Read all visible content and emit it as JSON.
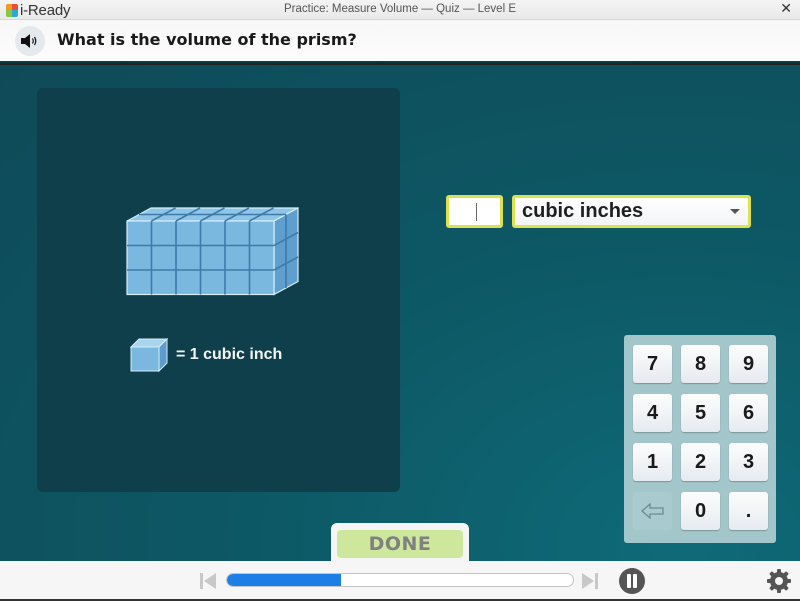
{
  "window": {
    "app_name": "i-Ready",
    "title": "Practice: Measure Volume — Quiz — Level E",
    "close_glyph": "✕"
  },
  "question": {
    "text": "What is the volume of the prism?",
    "speaker_icon": "speaker-icon"
  },
  "figure": {
    "prism_cubes": {
      "length": 6,
      "height": 3,
      "depth": 2
    },
    "legend_text": "= 1 cubic inch",
    "cube_color": "#7ab8e0"
  },
  "answer": {
    "input_value": "",
    "unit_selected": "cubic inches",
    "border_color": "#dfe04e"
  },
  "keypad": {
    "keys": [
      "7",
      "8",
      "9",
      "4",
      "5",
      "6",
      "1",
      "2",
      "3",
      "⇦",
      "0",
      "."
    ]
  },
  "done_button": {
    "label": "DONE"
  },
  "progress": {
    "fraction": 0.33,
    "color": "#1d7fe6"
  },
  "controls": {
    "prev_icon": "skip-back-icon",
    "next_icon": "skip-forward-icon",
    "pause_icon": "pause-icon",
    "settings_icon": "gear-icon"
  }
}
